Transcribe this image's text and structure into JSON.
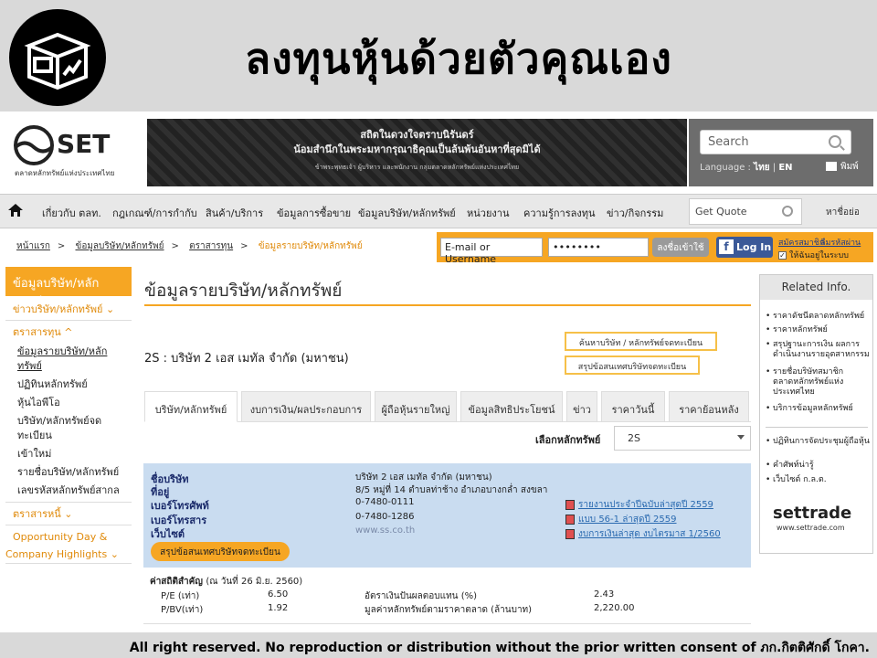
{
  "slogan": "ลงทุนหุ้นด้วยตัวคุณเอง",
  "footer": "All right reserved. No reproduction or distribution without the prior written consent of ภก.กิตติศักดิ์ โกคา.",
  "header": {
    "logo_text": "SET",
    "logo_sub": "ตลาดหลักทรัพย์แห่งประเทศไทย",
    "tribute_line1": "สถิตในดวงใจตราบนิรันดร์",
    "tribute_line2": "น้อมสำนึกในพระมหากรุณาธิคุณเป็นล้นพ้นอันหาที่สุดมิได้",
    "tribute_line3": "ข้าพระพุทธเจ้า ผู้บริหาร และพนักงาน กลุ่มตลาดหลักทรัพย์แห่งประเทศไทย",
    "search_placeholder": "Search",
    "language_label": "Language :",
    "lang_thai": "ไทย",
    "lang_sep": "|",
    "lang_en": "EN",
    "print_label": "พิมพ์"
  },
  "nav": {
    "items": [
      "เกี่ยวกับ ตลท.",
      "กฎเกณฑ์/การกำกับ",
      "สินค้า/บริการ",
      "ข้อมูลการซื้อขาย",
      "ข้อมูลบริษัท/หลักทรัพย์",
      "หน่วยงาน",
      "ความรู้การลงทุน",
      "ข่าว/กิจกรรม"
    ],
    "get_quote": "Get Quote",
    "name_unit": "หาชื่อย่อ"
  },
  "breadcrumb": {
    "items": [
      "หน้าแรก",
      "ข้อมูลบริษัท/หลักทรัพย์",
      "ตราสารทุน"
    ],
    "current": "ข้อมูลรายบริษัท/หลักทรัพย์",
    "sep": ">"
  },
  "login": {
    "email": "E-mail or Username",
    "password": "••••••••",
    "login_button": "ลงชื่อเข้าใช้",
    "fb_button": "Log In",
    "register": "สมัครสมาชิก",
    "forgot": "ลืมรหัสผ่าน",
    "remember": "ให้ฉันอยู่ในระบบ"
  },
  "sidebar": {
    "title": "ข้อมูลบริษัท/หลักทรัพย์",
    "section1": "ข่าวบริษัท/หลักทรัพย์ ⌄",
    "section2": "ตราสารทุน ^",
    "items": [
      "ข้อมูลรายบริษัท/หลักทรัพย์",
      "ปฏิทินหลักทรัพย์",
      "หุ้นไอพีโอ",
      "บริษัท/หลักทรัพย์จดทะเบียน",
      "เข้าใหม่",
      "รายชื่อบริษัท/หลักทรัพย์",
      "เลขรหัสหลักทรัพย์สากล"
    ],
    "section3": "ตราสารหนี้ ⌄",
    "section4a": "Opportunity Day &",
    "section4b": "Company Highlights ⌄"
  },
  "main": {
    "title": "ข้อมูลรายบริษัท/หลักทรัพย์",
    "company": "2S : บริษัท 2 เอส เมทัล จำกัด (มหาชน)",
    "btn_search_company": "ค้นหาบริษัท / หลักทรัพย์จดทะเบียน",
    "btn_summary_listed": "สรุปข้อสนเทศบริษัทจดทะเบียน",
    "tabs": [
      "บริษัท/หลักทรัพย์",
      "งบการเงิน/ผลประกอบการ",
      "ผู้ถือหุ้นรายใหญ่",
      "ข้อมูลสิทธิประโยชน์",
      "ข่าว",
      "ราคาวันนี้",
      "ราคาย้อนหลัง"
    ],
    "select_label": "เลือกหลักทรัพย์",
    "select_value": "2S"
  },
  "info": {
    "labels": [
      "ชื่อบริษัท",
      "ที่อยู่",
      "เบอร์โทรศัพท์",
      "เบอร์โทรสาร",
      "เว็บไซต์"
    ],
    "values": [
      "บริษัท 2 เอส เมทัล จำกัด (มหาชน)",
      "8/5 หมู่ที่ 14 ตำบลท่าช้าง อำเภอบางกล่ำ สงขลา",
      "0-7480-0111",
      "0-7480-1286",
      "www.ss.co.th"
    ],
    "links": [
      "รายงานประจำปีฉบับล่าสุดปี 2559",
      "แบบ 56-1 ล่าสุดปี 2559",
      "งบการเงินล่าสุด งบไตรมาส 1/2560"
    ],
    "summary_button": "สรุปข้อสนเทศบริษัทจดทะเบียน"
  },
  "stats": {
    "title": "ค่าสถิติสำคัญ",
    "date": "(ณ วันที่ 26 มิ.ย. 2560)",
    "pe_label": "P/E (เท่า)",
    "pe_value": "6.50",
    "pbv_label": "P/BV(เท่า)",
    "pbv_value": "1.92",
    "yield_label": "อัตราเงินปันผลตอบแทน (%)",
    "yield_value": "2.43",
    "mcap_label": "มูลค่าหลักทรัพย์ตามราคาตลาด (ล้านบาท)",
    "mcap_value": "2,220.00"
  },
  "related": {
    "title": "Related Info.",
    "items": [
      "ราคาดัชนีตลาดหลักทรัพย์",
      "ราคาหลักทรัพย์",
      "สรุปฐานะการเงิน ผลการดำเนินงานรายอุตสาหกรรม",
      "รายชื่อบริษัทสมาชิก ตลาดหลักทรัพย์แห่งประเทศไทย",
      "บริการข้อมูลหลักทรัพย์"
    ],
    "items2": [
      "ปฏิทินการจัดประชุมผู้ถือหุ้น",
      "คำศัพท์น่ารู้",
      "เว็บไซต์ ก.ล.ต."
    ],
    "settrade": "settrade",
    "settrade_url": "www.settrade.com"
  }
}
